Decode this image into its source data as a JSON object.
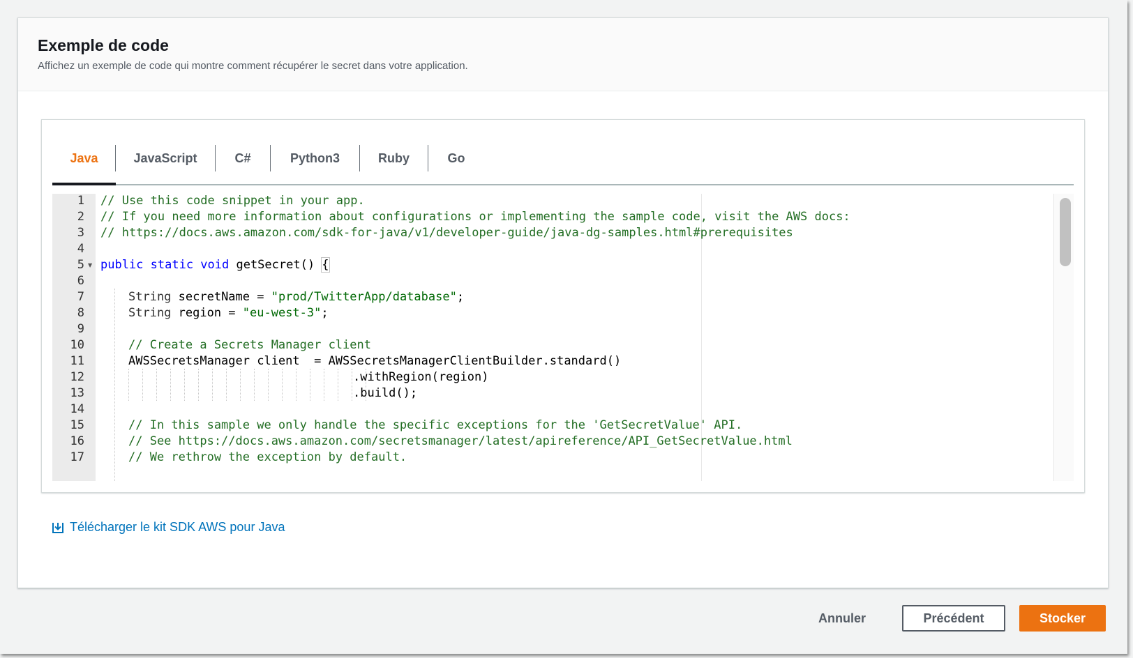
{
  "section": {
    "title": "Exemple de code",
    "description": "Affichez un exemple de code qui montre comment récupérer le secret dans votre application."
  },
  "tabs": [
    {
      "label": "Java",
      "active": true
    },
    {
      "label": "JavaScript",
      "active": false
    },
    {
      "label": "C#",
      "active": false
    },
    {
      "label": "Python3",
      "active": false
    },
    {
      "label": "Ruby",
      "active": false
    },
    {
      "label": "Go",
      "active": false
    }
  ],
  "code": {
    "language": "Java",
    "line_numbers": [
      "1",
      "2",
      "3",
      "4",
      "5",
      "6",
      "7",
      "8",
      "9",
      "10",
      "11",
      "12",
      "13",
      "14",
      "15",
      "16",
      "17"
    ],
    "lines": {
      "l1": "// Use this code snippet in your app.",
      "l2": "// If you need more information about configurations or implementing the sample code, visit the AWS docs:",
      "l3": "// https://docs.aws.amazon.com/sdk-for-java/v1/developer-guide/java-dg-samples.html#prerequisites",
      "l5_kw": "public static void",
      "l5_rest": " getSecret() ",
      "l5_brace": "{",
      "l7_type": "String",
      "l7_mid": " secretName = ",
      "l7_str": "\"prod/TwitterApp/database\"",
      "l7_end": ";",
      "l8_type": "String",
      "l8_mid": " region = ",
      "l8_str": "\"eu-west-3\"",
      "l8_end": ";",
      "l10": "// Create a Secrets Manager client",
      "l11": "AWSSecretsManager client  = AWSSecretsManagerClientBuilder.standard()",
      "l12": ".withRegion(region)",
      "l13": ".build();",
      "l15": "// In this sample we only handle the specific exceptions for the 'GetSecretValue' API.",
      "l16": "// See https://docs.aws.amazon.com/secretsmanager/latest/apireference/API_GetSecretValue.html",
      "l17": "// We rethrow the exception by default."
    }
  },
  "download_link": {
    "label": "Télécharger le kit SDK AWS pour Java",
    "icon": "download-icon"
  },
  "actions": {
    "cancel": "Annuler",
    "previous": "Précédent",
    "submit": "Stocker"
  },
  "colors": {
    "accent": "#ec7211",
    "link": "#0073bb",
    "comment": "#236e24",
    "keyword": "#0000ff",
    "string": "#036a07"
  }
}
